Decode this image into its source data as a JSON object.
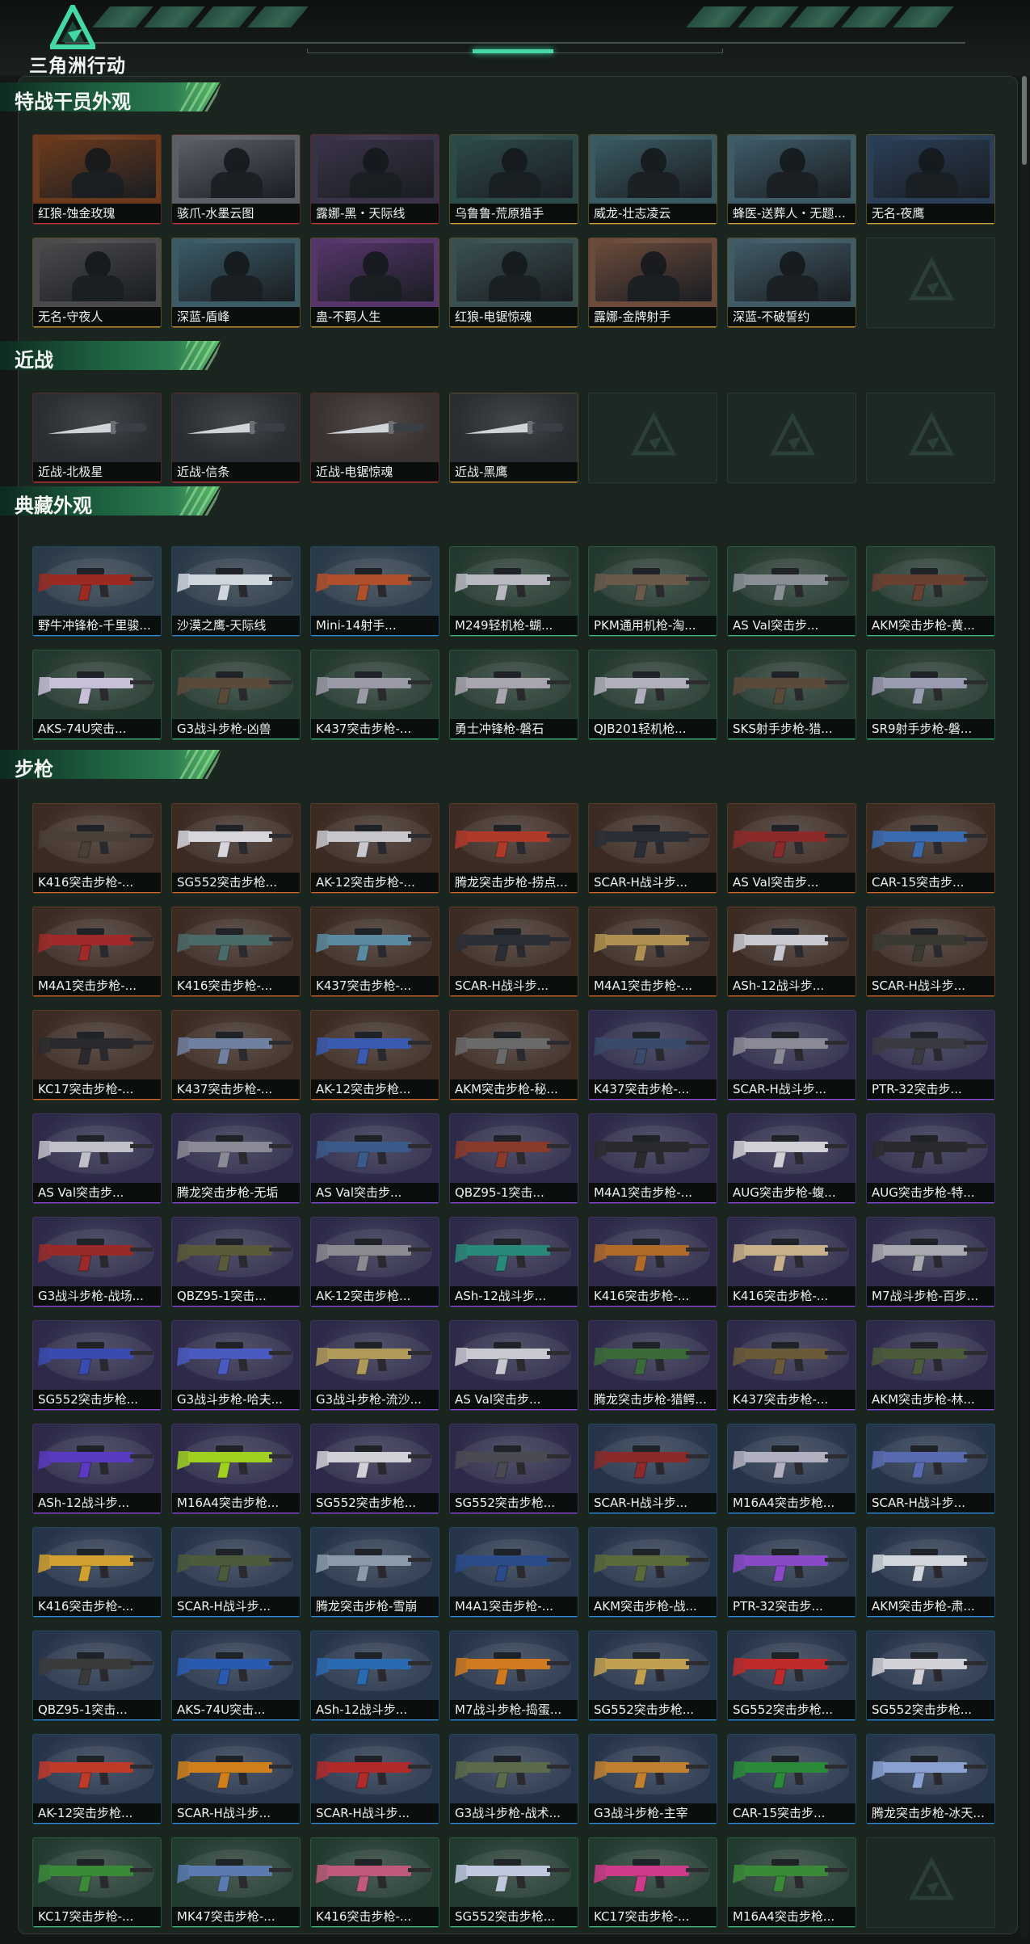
{
  "app": {
    "logo_text": "三角洲行动"
  },
  "colors": {
    "gold": "#d8a33a",
    "orange": "#d6692a",
    "purple": "#8b4ae0",
    "blue": "#2f8ee0",
    "green": "#3fbf7a",
    "red": "#c8353b"
  },
  "sections": [
    {
      "title": "特战干员外观",
      "kind": "operator",
      "items": [
        {
          "label": "红狼-蚀金玫瑰",
          "rarity": "red",
          "tone": "#6b3a1c"
        },
        {
          "label": "骇爪-水墨云图",
          "rarity": "red",
          "tone": "#5a5f68"
        },
        {
          "label": "露娜-黑・天际线",
          "rarity": "red",
          "tone": "#3a3348"
        },
        {
          "label": "乌鲁鲁-荒原猎手",
          "rarity": "gold",
          "tone": "#2d4a4a"
        },
        {
          "label": "威龙-壮志凌云",
          "rarity": "gold",
          "tone": "#3a5a62"
        },
        {
          "label": "蜂医-送葬人・无题...",
          "rarity": "gold",
          "tone": "#3e5b68"
        },
        {
          "label": "无名-夜鹰",
          "rarity": "gold",
          "tone": "#2a3e56"
        },
        {
          "label": "无名-守夜人",
          "rarity": "gold",
          "tone": "#4a4a4c"
        },
        {
          "label": "深蓝-盾峰",
          "rarity": "gold",
          "tone": "#3a5a66"
        },
        {
          "label": "蛊-不羁人生",
          "rarity": "gold",
          "tone": "#55356a"
        },
        {
          "label": "红狼-电锯惊魂",
          "rarity": "gold",
          "tone": "#3a5050"
        },
        {
          "label": "露娜-金牌射手",
          "rarity": "gold",
          "tone": "#6a4a3a"
        },
        {
          "label": "深蓝-不破誓约",
          "rarity": "gold",
          "tone": "#405a66"
        },
        {
          "empty": true
        }
      ]
    },
    {
      "title": "近战",
      "kind": "melee",
      "items": [
        {
          "label": "近战-北极星",
          "rarity": "red",
          "tone": "#2a2d31"
        },
        {
          "label": "近战-信条",
          "rarity": "red",
          "tone": "#2a2d31"
        },
        {
          "label": "近战-电锯惊魂",
          "rarity": "red",
          "tone": "#3a3231"
        },
        {
          "label": "近战-黑鹰",
          "rarity": "gold",
          "tone": "#2a2d31"
        },
        {
          "empty": true
        },
        {
          "empty": true
        },
        {
          "empty": true
        }
      ]
    },
    {
      "title": "典藏外观",
      "kind": "gun",
      "items": [
        {
          "label": "野牛冲锋枪-千里骏...",
          "rarity": "blue",
          "tone": "#2b3a48",
          "gun": "#9a2a22"
        },
        {
          "label": "沙漠之鹰-天际线",
          "rarity": "blue",
          "tone": "#2b3a48",
          "gun": "#d0d6de"
        },
        {
          "label": "Mini-14射手...",
          "rarity": "blue",
          "tone": "#2b3a48",
          "gun": "#b0502a"
        },
        {
          "label": "M249轻机枪-蝴...",
          "rarity": "green",
          "tone": "#23382e",
          "gun": "#b8b8c2"
        },
        {
          "label": "PKM通用机枪-淘...",
          "rarity": "green",
          "tone": "#23382e",
          "gun": "#6a5a4a"
        },
        {
          "label": "AS Val突击步...",
          "rarity": "green",
          "tone": "#23382e",
          "gun": "#8a8f96"
        },
        {
          "label": "AKM突击步枪-黄...",
          "rarity": "green",
          "tone": "#23382e",
          "gun": "#6a4030"
        },
        {
          "label": "AKS-74U突击...",
          "rarity": "green",
          "tone": "#23382e",
          "gun": "#c8c0d8"
        },
        {
          "label": "G3战斗步枪-凶兽",
          "rarity": "green",
          "tone": "#23382e",
          "gun": "#5a4a3a"
        },
        {
          "label": "K437突击步枪-...",
          "rarity": "green",
          "tone": "#23382e",
          "gun": "#9a9aa6"
        },
        {
          "label": "勇士冲锋枪-磐石",
          "rarity": "green",
          "tone": "#23382e",
          "gun": "#a8a4b0"
        },
        {
          "label": "QJB201轻机枪...",
          "rarity": "green",
          "tone": "#23382e",
          "gun": "#b0b0bc"
        },
        {
          "label": "SKS射手步枪-猎...",
          "rarity": "green",
          "tone": "#23382e",
          "gun": "#5a4a3a"
        },
        {
          "label": "SR9射手步枪-磐...",
          "rarity": "green",
          "tone": "#23382e",
          "gun": "#9a9ab0"
        }
      ]
    },
    {
      "title": "步枪",
      "kind": "gun",
      "items": [
        {
          "label": "K416突击步枪-...",
          "rarity": "orange",
          "tone": "#3a2a22",
          "gun": "#4a4038"
        },
        {
          "label": "SG552突击步枪...",
          "rarity": "orange",
          "tone": "#3a2a22",
          "gun": "#d6d6dc"
        },
        {
          "label": "AK-12突击步枪-...",
          "rarity": "orange",
          "tone": "#3a2a22",
          "gun": "#c8c8cc"
        },
        {
          "label": "腾龙突击步枪-捞点...",
          "rarity": "orange",
          "tone": "#3a2a22",
          "gun": "#b03a2a"
        },
        {
          "label": "SCAR-H战斗步...",
          "rarity": "orange",
          "tone": "#3a2a22",
          "gun": "#2a2e36"
        },
        {
          "label": "AS Val突击步...",
          "rarity": "orange",
          "tone": "#3a2a22",
          "gun": "#8a2a2a"
        },
        {
          "label": "CAR-15突击步...",
          "rarity": "orange",
          "tone": "#3a2a22",
          "gun": "#3a6ab0"
        },
        {
          "label": "M4A1突击步枪-...",
          "rarity": "orange",
          "tone": "#3a2a22",
          "gun": "#a02a2a"
        },
        {
          "label": "K416突击步枪-...",
          "rarity": "orange",
          "tone": "#3a2a22",
          "gun": "#4a6a6a"
        },
        {
          "label": "K437突击步枪-...",
          "rarity": "orange",
          "tone": "#3a2a22",
          "gun": "#5a8aa0"
        },
        {
          "label": "SCAR-H战斗步...",
          "rarity": "orange",
          "tone": "#3a2a22",
          "gun": "#2a2e36"
        },
        {
          "label": "M4A1突击步枪-...",
          "rarity": "orange",
          "tone": "#3a2a22",
          "gun": "#b09050"
        },
        {
          "label": "ASh-12战斗步...",
          "rarity": "orange",
          "tone": "#3a2a22",
          "gun": "#c8c8d0"
        },
        {
          "label": "SCAR-H战斗步...",
          "rarity": "orange",
          "tone": "#3a2a22",
          "gun": "#3a3a32"
        },
        {
          "label": "KC17突击步枪-...",
          "rarity": "orange",
          "tone": "#3a2a22",
          "gun": "#2a2a2e"
        },
        {
          "label": "K437突击步枪-...",
          "rarity": "orange",
          "tone": "#3a2a22",
          "gun": "#7080a0"
        },
        {
          "label": "AK-12突击步枪...",
          "rarity": "orange",
          "tone": "#3a2a22",
          "gun": "#3a5ab0"
        },
        {
          "label": "AKM突击步枪-秘...",
          "rarity": "orange",
          "tone": "#3a2a22",
          "gun": "#6a6a6a"
        },
        {
          "label": "K437突击步枪-...",
          "rarity": "purple",
          "tone": "#2c2a48",
          "gun": "#3a4a6a"
        },
        {
          "label": "SCAR-H战斗步...",
          "rarity": "purple",
          "tone": "#2c2a48",
          "gun": "#8a8a96"
        },
        {
          "label": "PTR-32突击步...",
          "rarity": "purple",
          "tone": "#2c2a48",
          "gun": "#3a3a42"
        },
        {
          "label": "AS Val突击步...",
          "rarity": "purple",
          "tone": "#2c2a48",
          "gun": "#c0c0c8"
        },
        {
          "label": "腾龙突击步枪-无垢",
          "rarity": "purple",
          "tone": "#2c2a48",
          "gun": "#8a8a96"
        },
        {
          "label": "AS Val突击步...",
          "rarity": "purple",
          "tone": "#2c2a48",
          "gun": "#3a5a8a"
        },
        {
          "label": "QBZ95-1突击...",
          "rarity": "purple",
          "tone": "#2c2a48",
          "gun": "#8a3a2a"
        },
        {
          "label": "M4A1突击步枪-...",
          "rarity": "purple",
          "tone": "#2c2a48",
          "gun": "#2a2a2e"
        },
        {
          "label": "AUG突击步枪-蝮...",
          "rarity": "purple",
          "tone": "#2c2a48",
          "gun": "#d0d0d6"
        },
        {
          "label": "AUG突击步枪-特...",
          "rarity": "purple",
          "tone": "#2c2a48",
          "gun": "#2a2a2e"
        },
        {
          "label": "G3战斗步枪-战场...",
          "rarity": "purple",
          "tone": "#2c2a48",
          "gun": "#9a2a2a"
        },
        {
          "label": "QBZ95-1突击...",
          "rarity": "purple",
          "tone": "#2c2a48",
          "gun": "#5a5a3a"
        },
        {
          "label": "AK-12突击步枪...",
          "rarity": "purple",
          "tone": "#2c2a48",
          "gun": "#8a8a90"
        },
        {
          "label": "ASh-12战斗步...",
          "rarity": "purple",
          "tone": "#2c2a48",
          "gun": "#2a8a7a"
        },
        {
          "label": "K416突击步枪-...",
          "rarity": "purple",
          "tone": "#2c2a48",
          "gun": "#b06a2a"
        },
        {
          "label": "K416突击步枪-...",
          "rarity": "purple",
          "tone": "#2c2a48",
          "gun": "#c8b08a"
        },
        {
          "label": "M7战斗步枪-百步...",
          "rarity": "purple",
          "tone": "#2c2a48",
          "gun": "#a8a8b0"
        },
        {
          "label": "SG552突击步枪...",
          "rarity": "purple",
          "tone": "#2c2a48",
          "gun": "#3a4ab0"
        },
        {
          "label": "G3战斗步枪-哈夫...",
          "rarity": "purple",
          "tone": "#2c2a48",
          "gun": "#4a5ac0"
        },
        {
          "label": "G3战斗步枪-流沙...",
          "rarity": "purple",
          "tone": "#2c2a48",
          "gun": "#b09a5a"
        },
        {
          "label": "AS Val突击步...",
          "rarity": "purple",
          "tone": "#2c2a48",
          "gun": "#c8c8d0"
        },
        {
          "label": "腾龙突击步枪-猎鳄...",
          "rarity": "purple",
          "tone": "#2c2a48",
          "gun": "#3a6a3a"
        },
        {
          "label": "K437突击步枪-...",
          "rarity": "purple",
          "tone": "#2c2a48",
          "gun": "#6a5a3a"
        },
        {
          "label": "AKM突击步枪-林...",
          "rarity": "purple",
          "tone": "#2c2a48",
          "gun": "#4a5a3a"
        },
        {
          "label": "ASh-12战斗步...",
          "rarity": "purple",
          "tone": "#2c2a48",
          "gun": "#5a3ac0"
        },
        {
          "label": "M16A4突击步枪...",
          "rarity": "purple",
          "tone": "#2c2a48",
          "gun": "#a0d020"
        },
        {
          "label": "SG552突击步枪...",
          "rarity": "purple",
          "tone": "#2c2a48",
          "gun": "#d0d0d6"
        },
        {
          "label": "SG552突击步枪...",
          "rarity": "purple",
          "tone": "#2c2a48",
          "gun": "#4a4a52"
        },
        {
          "label": "SCAR-H战斗步...",
          "rarity": "blue",
          "tone": "#26344a",
          "gun": "#8a2a2a"
        },
        {
          "label": "M16A4突击步枪...",
          "rarity": "blue",
          "tone": "#26344a",
          "gun": "#b0b0c0"
        },
        {
          "label": "SCAR-H战斗步...",
          "rarity": "blue",
          "tone": "#26344a",
          "gun": "#5a6ab0"
        },
        {
          "label": "K416突击步枪-...",
          "rarity": "blue",
          "tone": "#26344a",
          "gun": "#d0a030"
        },
        {
          "label": "SCAR-H战斗步...",
          "rarity": "blue",
          "tone": "#26344a",
          "gun": "#4a5a3a"
        },
        {
          "label": "腾龙突击步枪-雪崩",
          "rarity": "blue",
          "tone": "#26344a",
          "gun": "#8a9aa8"
        },
        {
          "label": "M4A1突击步枪-...",
          "rarity": "blue",
          "tone": "#26344a",
          "gun": "#2a4a8a"
        },
        {
          "label": "AKM突击步枪-战...",
          "rarity": "blue",
          "tone": "#26344a",
          "gun": "#5a6a3a"
        },
        {
          "label": "PTR-32突击步...",
          "rarity": "blue",
          "tone": "#26344a",
          "gun": "#8a4ac8"
        },
        {
          "label": "AKM突击步枪-肃...",
          "rarity": "blue",
          "tone": "#26344a",
          "gun": "#d0d6dc"
        },
        {
          "label": "QBZ95-1突击...",
          "rarity": "blue",
          "tone": "#26344a",
          "gun": "#3a3a3a"
        },
        {
          "label": "AKS-74U突击...",
          "rarity": "blue",
          "tone": "#26344a",
          "gun": "#2a5ab0"
        },
        {
          "label": "ASh-12战斗步...",
          "rarity": "blue",
          "tone": "#26344a",
          "gun": "#2a6ab0"
        },
        {
          "label": "M7战斗步枪-捣蛋...",
          "rarity": "blue",
          "tone": "#26344a",
          "gun": "#d07a20"
        },
        {
          "label": "SG552突击步枪...",
          "rarity": "blue",
          "tone": "#26344a",
          "gun": "#c0a050"
        },
        {
          "label": "SG552突击步枪...",
          "rarity": "blue",
          "tone": "#26344a",
          "gun": "#c02a2a"
        },
        {
          "label": "SG552突击步枪...",
          "rarity": "blue",
          "tone": "#26344a",
          "gun": "#d0d0d6"
        },
        {
          "label": "AK-12突击步枪...",
          "rarity": "blue",
          "tone": "#26344a",
          "gun": "#c03a2a"
        },
        {
          "label": "SCAR-H战斗步...",
          "rarity": "blue",
          "tone": "#26344a",
          "gun": "#d0801a"
        },
        {
          "label": "SCAR-H战斗步...",
          "rarity": "blue",
          "tone": "#26344a",
          "gun": "#b02a2a"
        },
        {
          "label": "G3战斗步枪-战术...",
          "rarity": "blue",
          "tone": "#26344a",
          "gun": "#5a6a4a"
        },
        {
          "label": "G3战斗步枪-主宰",
          "rarity": "blue",
          "tone": "#26344a",
          "gun": "#c08030"
        },
        {
          "label": "CAR-15突击步...",
          "rarity": "blue",
          "tone": "#26344a",
          "gun": "#2a8a3a"
        },
        {
          "label": "腾龙突击步枪-冰天...",
          "rarity": "blue",
          "tone": "#26344a",
          "gun": "#8aa0d0"
        },
        {
          "label": "KC17突击步枪-...",
          "rarity": "green",
          "tone": "#223a30",
          "gun": "#3a8a3a"
        },
        {
          "label": "MK47突击步枪-...",
          "rarity": "green",
          "tone": "#223a30",
          "gun": "#5a7ab0"
        },
        {
          "label": "K416突击步枪-...",
          "rarity": "green",
          "tone": "#223a30",
          "gun": "#c05a7a"
        },
        {
          "label": "SG552突击步枪...",
          "rarity": "green",
          "tone": "#223a30",
          "gun": "#c0c8e0"
        },
        {
          "label": "KC17突击步枪-...",
          "rarity": "green",
          "tone": "#223a30",
          "gun": "#d03a8a"
        },
        {
          "label": "M16A4突击步枪...",
          "rarity": "green",
          "tone": "#223a30",
          "gun": "#3a8a3a"
        },
        {
          "empty": true
        }
      ]
    }
  ]
}
